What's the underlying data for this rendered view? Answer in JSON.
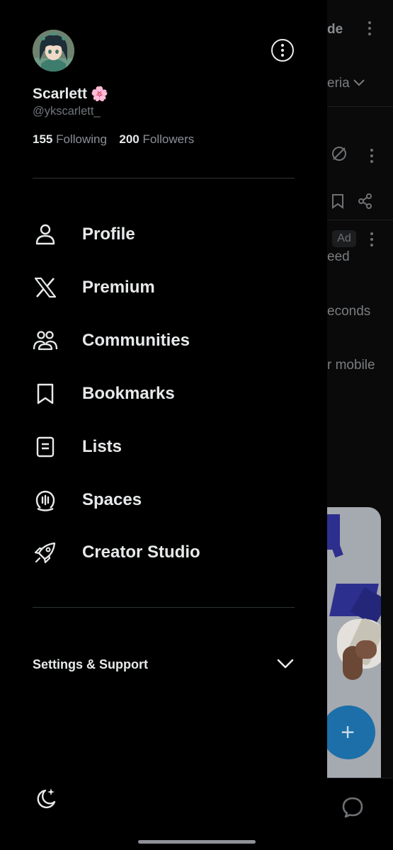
{
  "profile": {
    "name": "Scarlett",
    "name_emoji": "🌸",
    "handle": "@ykscarlett_",
    "following_count": "155",
    "following_label": "Following",
    "followers_count": "200",
    "followers_label": "Followers"
  },
  "menu": [
    {
      "id": "profile",
      "label": "Profile",
      "icon": "person-icon"
    },
    {
      "id": "premium",
      "label": "Premium",
      "icon": "x-logo-icon"
    },
    {
      "id": "communities",
      "label": "Communities",
      "icon": "communities-icon"
    },
    {
      "id": "bookmarks",
      "label": "Bookmarks",
      "icon": "bookmark-icon"
    },
    {
      "id": "lists",
      "label": "Lists",
      "icon": "list-icon"
    },
    {
      "id": "spaces",
      "label": "Spaces",
      "icon": "spaces-icon"
    },
    {
      "id": "creator-studio",
      "label": "Creator Studio",
      "icon": "rocket-icon"
    }
  ],
  "settings": {
    "label": "Settings & Support"
  },
  "background_feed": {
    "top_text": "de",
    "dropdown_text": "eria",
    "ad_badge": "Ad",
    "line1": "eed",
    "line2": "econds",
    "line3": "r mobile"
  },
  "colors": {
    "background": "#000000",
    "text_primary": "#e7e9ea",
    "text_secondary": "#71767b",
    "divider": "#2f3336",
    "fab": "#1d9bf0"
  }
}
